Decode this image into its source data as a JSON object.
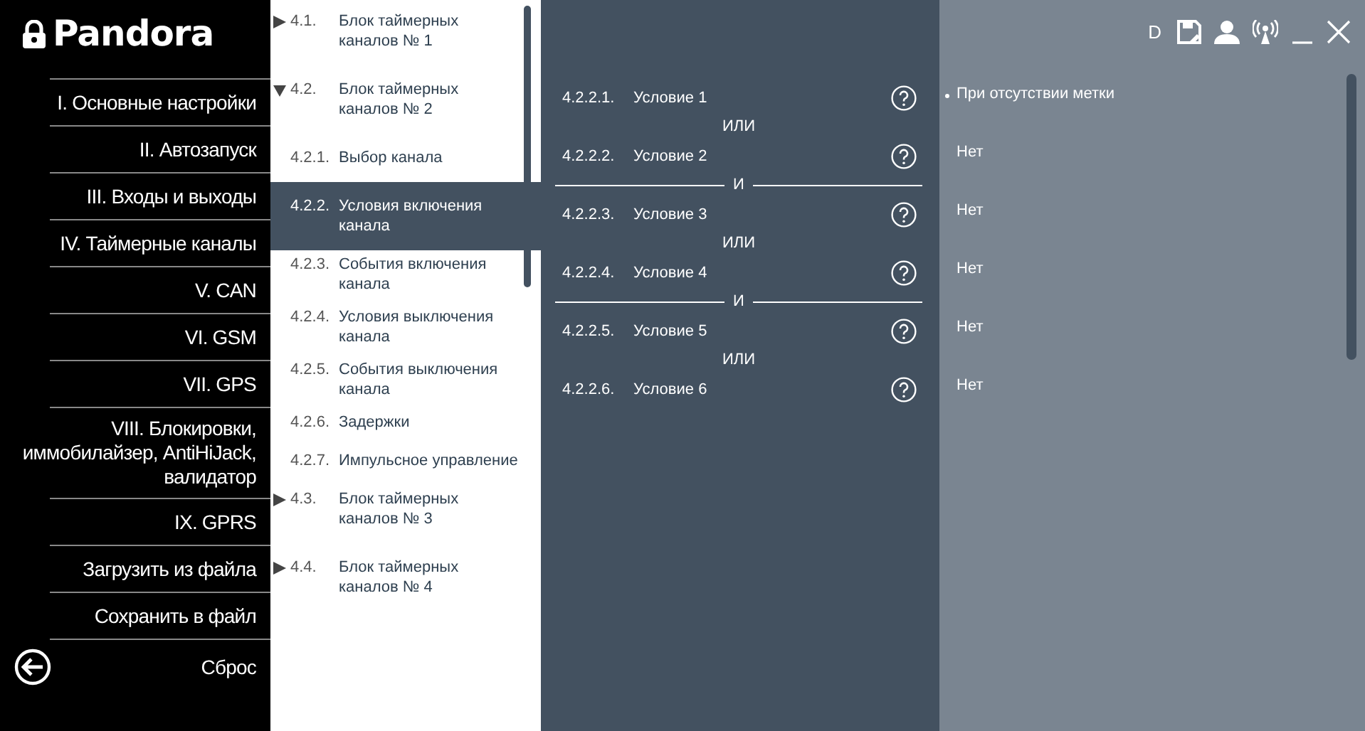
{
  "logo": {
    "text": "Pandora"
  },
  "sidebar": {
    "items": [
      {
        "label": "I. Основные настройки"
      },
      {
        "label": "II. Автозапуск"
      },
      {
        "label": "III. Входы и выходы"
      },
      {
        "label": "IV. Таймерные каналы"
      },
      {
        "label": "V. CAN"
      },
      {
        "label": "VI. GSM"
      },
      {
        "label": "VII. GPS"
      },
      {
        "label": "VIII. Блокировки, иммобилайзер, AntiHiJack, валидатор"
      },
      {
        "label": "IX. GPRS"
      },
      {
        "label": "Загрузить из файла"
      },
      {
        "label": "Сохранить в файл"
      },
      {
        "label": "Сброс"
      }
    ]
  },
  "tree": {
    "items": [
      {
        "number": "4.1.",
        "label": "Блок таймерных каналов № 1",
        "expanded": false,
        "selected": false
      },
      {
        "number": "4.2.",
        "label": "Блок таймерных каналов № 2",
        "expanded": true,
        "selected": false,
        "children": [
          {
            "number": "4.2.1.",
            "label": "Выбор канала",
            "selected": false
          },
          {
            "number": "4.2.2.",
            "label": "Условия включения канала",
            "selected": true
          },
          {
            "number": "4.2.3.",
            "label": "События включения канала",
            "selected": false
          },
          {
            "number": "4.2.4.",
            "label": "Условия выключения канала",
            "selected": false
          },
          {
            "number": "4.2.5.",
            "label": "События выключения канала",
            "selected": false
          },
          {
            "number": "4.2.6.",
            "label": "Задержки",
            "selected": false
          },
          {
            "number": "4.2.7.",
            "label": "Импульсное управление",
            "selected": false
          }
        ]
      },
      {
        "number": "4.3.",
        "label": "Блок таймерных каналов № 3",
        "expanded": false,
        "selected": false
      },
      {
        "number": "4.4.",
        "label": "Блок таймерных каналов № 4",
        "expanded": false,
        "selected": false
      }
    ]
  },
  "toolbar": {
    "user_badge": "D"
  },
  "conditions": [
    {
      "number": "4.2.2.1.",
      "label": "Условие 1",
      "value": "При отсутствии метки",
      "bulleted": true,
      "joiner": {
        "kind": "or",
        "label": "ИЛИ"
      }
    },
    {
      "number": "4.2.2.2.",
      "label": "Условие 2",
      "value": "Нет",
      "bulleted": false,
      "joiner": {
        "kind": "and",
        "label": "И"
      }
    },
    {
      "number": "4.2.2.3.",
      "label": "Условие 3",
      "value": "Нет",
      "bulleted": false,
      "joiner": {
        "kind": "or",
        "label": "ИЛИ"
      }
    },
    {
      "number": "4.2.2.4.",
      "label": "Условие 4",
      "value": "Нет",
      "bulleted": false,
      "joiner": {
        "kind": "and",
        "label": "И"
      }
    },
    {
      "number": "4.2.2.5.",
      "label": "Условие 5",
      "value": "Нет",
      "bulleted": false,
      "joiner": {
        "kind": "or",
        "label": "ИЛИ"
      }
    },
    {
      "number": "4.2.2.6.",
      "label": "Условие 6",
      "value": "Нет",
      "bulleted": false
    }
  ]
}
